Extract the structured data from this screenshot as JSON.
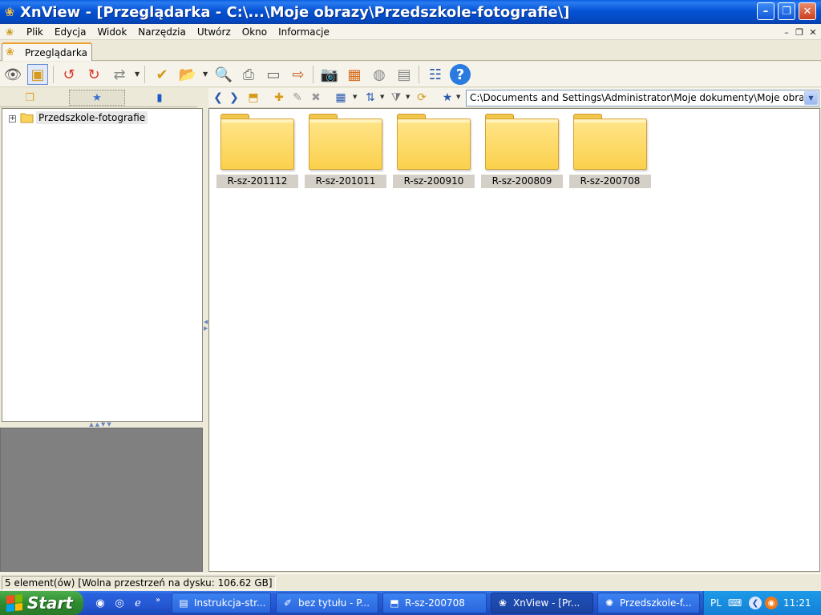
{
  "window": {
    "title": "XnView - [Przeglądarka - C:\\...\\Moje obrazy\\Przedszkole-fotografie\\]",
    "minimize_glyph": "–",
    "maximize_glyph": "❐",
    "close_glyph": "✕"
  },
  "menu": {
    "items": [
      "Plik",
      "Edycja",
      "Widok",
      "Narzędzia",
      "Utwórz",
      "Okno",
      "Informacje"
    ]
  },
  "tabs": {
    "browser_label": "Przeglądarka"
  },
  "toolbar": {
    "icons": [
      "eye-icon",
      "fullscreen-icon",
      "rotate-left-icon",
      "rotate-right-icon",
      "convert-icon",
      "select-icon",
      "open-folder-icon",
      "zoom-icon",
      "print-icon",
      "scanner-icon",
      "export-icon",
      "camera-icon",
      "slideshow-icon",
      "web-icon",
      "contact-sheet-icon",
      "settings-icon",
      "help-icon"
    ]
  },
  "navigation": {
    "path": "C:\\Documents and Settings\\Administrator\\Moje dokumenty\\Moje obrazy\\Przedszkole-fotografie\\"
  },
  "tree": {
    "root_label": "Przedszkole-fotografie"
  },
  "files": {
    "items": [
      {
        "name": "R-sz-201112"
      },
      {
        "name": "R-sz-201011"
      },
      {
        "name": "R-sz-200910"
      },
      {
        "name": "R-sz-200809"
      },
      {
        "name": "R-sz-200708"
      }
    ]
  },
  "status": {
    "text": "5 element(ów) [Wolna przestrzeń na dysku: 106.62 GB]"
  },
  "taskbar": {
    "start_label": "Start",
    "tasks": [
      {
        "label": "Instrukcja-str...",
        "icon": "word-doc-icon"
      },
      {
        "label": "bez tytułu - P...",
        "icon": "paint-icon"
      },
      {
        "label": "R-sz-200708",
        "icon": "explorer-folder-icon"
      },
      {
        "label": "XnView - [Pr...",
        "icon": "xnview-icon"
      },
      {
        "label": "Przedszkole-f...",
        "icon": "image-viewer-icon"
      }
    ],
    "tray_language": "PL",
    "clock": "11:21"
  },
  "colors": {
    "titlebar_blue": "#0553d6",
    "folder_yellow": "#fbd04c",
    "taskbar_blue": "#2457d4",
    "start_green": "#2e8c2e",
    "tray_blue": "#1480d6"
  }
}
